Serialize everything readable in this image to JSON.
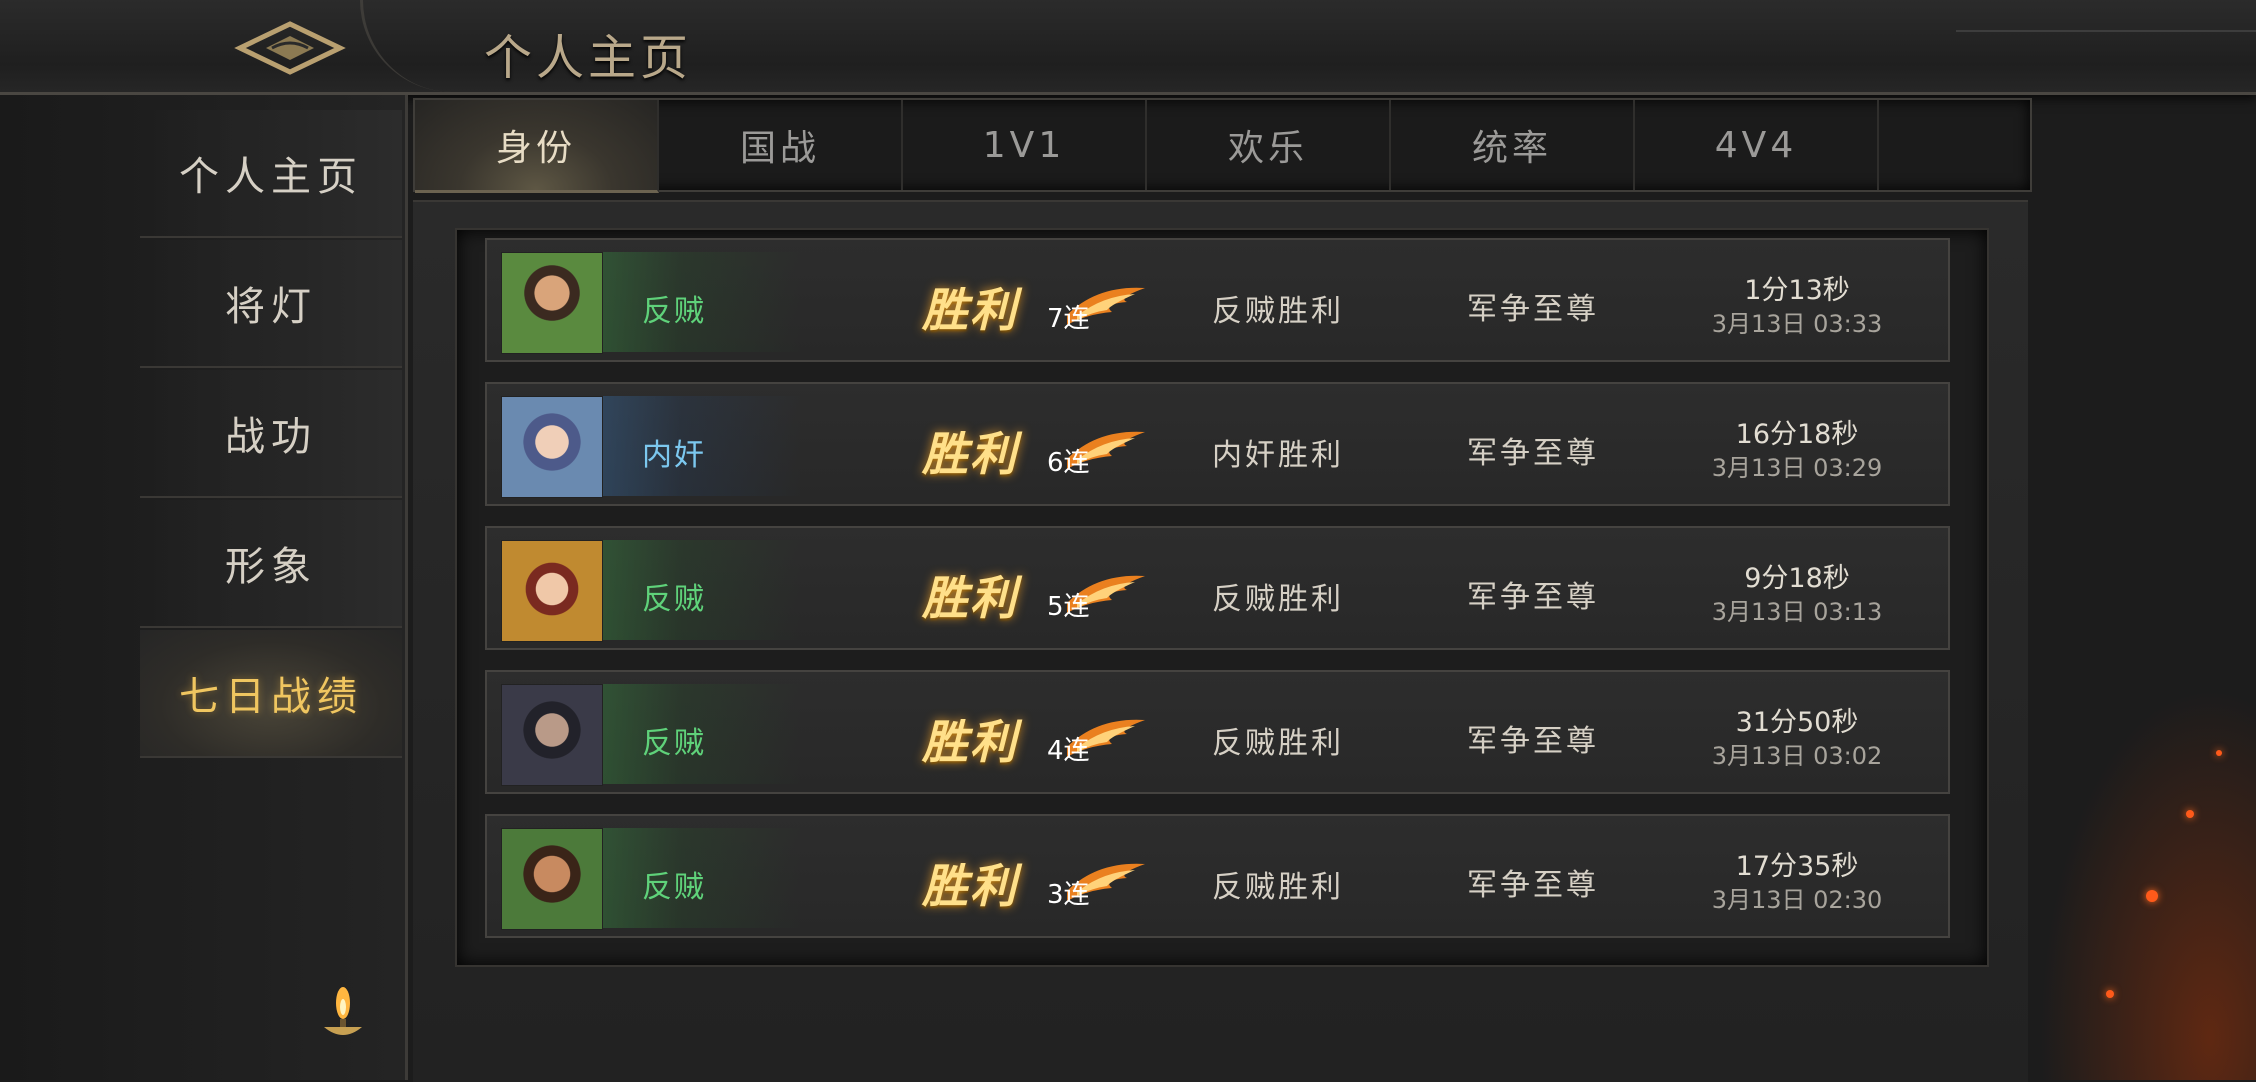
{
  "header": {
    "title": "个人主页"
  },
  "sidebar": {
    "items": [
      {
        "label": "个人主页"
      },
      {
        "label": "将灯"
      },
      {
        "label": "战功"
      },
      {
        "label": "形象"
      },
      {
        "label": "七日战绩"
      }
    ],
    "active_index": 4
  },
  "tabs": [
    {
      "label": "身份"
    },
    {
      "label": "国战"
    },
    {
      "label": "1V1"
    },
    {
      "label": "欢乐"
    },
    {
      "label": "统率"
    },
    {
      "label": "4V4"
    }
  ],
  "active_tab_index": 0,
  "colors": {
    "gold": "#f0c660",
    "rebel_green": "#5fd27a",
    "traitor_blue": "#7cc8ef"
  },
  "records": [
    {
      "faction": "反贼",
      "faction_type": "rebel",
      "result": "胜利",
      "streak": "7连",
      "outcome": "反贼胜利",
      "rank": "军争至尊",
      "duration": "1分13秒",
      "datetime": "3月13日 03:33"
    },
    {
      "faction": "内奸",
      "faction_type": "traitor",
      "result": "胜利",
      "streak": "6连",
      "outcome": "内奸胜利",
      "rank": "军争至尊",
      "duration": "16分18秒",
      "datetime": "3月13日 03:29"
    },
    {
      "faction": "反贼",
      "faction_type": "rebel",
      "result": "胜利",
      "streak": "5连",
      "outcome": "反贼胜利",
      "rank": "军争至尊",
      "duration": "9分18秒",
      "datetime": "3月13日 03:13"
    },
    {
      "faction": "反贼",
      "faction_type": "rebel",
      "result": "胜利",
      "streak": "4连",
      "outcome": "反贼胜利",
      "rank": "军争至尊",
      "duration": "31分50秒",
      "datetime": "3月13日 03:02"
    },
    {
      "faction": "反贼",
      "faction_type": "rebel",
      "result": "胜利",
      "streak": "3连",
      "outcome": "反贼胜利",
      "rank": "军争至尊",
      "duration": "17分35秒",
      "datetime": "3月13日 02:30"
    }
  ]
}
